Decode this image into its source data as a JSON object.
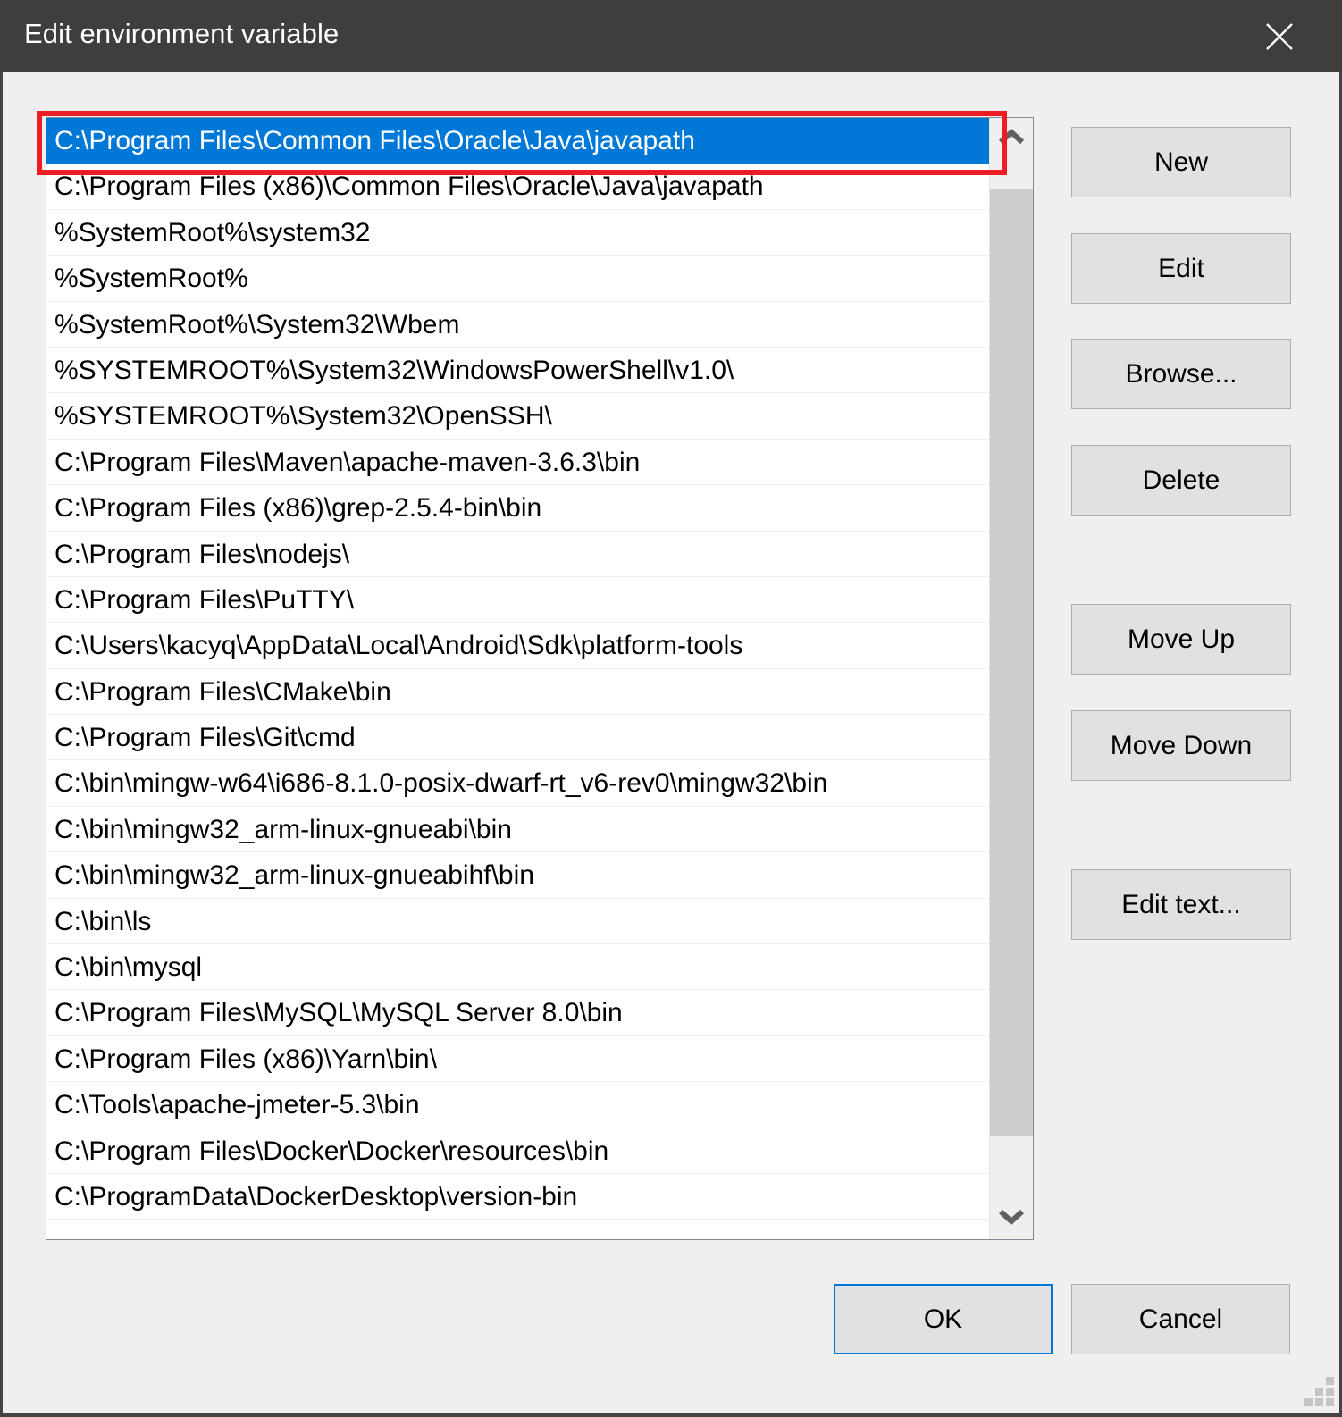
{
  "window": {
    "title": "Edit environment variable",
    "close_icon": "close-icon"
  },
  "colors": {
    "titlebar_bg": "#403e3c",
    "selection_blue": "#0078d7",
    "annotation_red": "#ec1c24",
    "dialog_bg": "#efefef",
    "button_face": "#e1e1e1",
    "scroll_thumb": "#cdcdcd"
  },
  "list": {
    "selected_index": 0,
    "items": [
      "C:\\Program Files\\Common Files\\Oracle\\Java\\javapath",
      "C:\\Program Files (x86)\\Common Files\\Oracle\\Java\\javapath",
      "%SystemRoot%\\system32",
      "%SystemRoot%",
      "%SystemRoot%\\System32\\Wbem",
      "%SYSTEMROOT%\\System32\\WindowsPowerShell\\v1.0\\",
      "%SYSTEMROOT%\\System32\\OpenSSH\\",
      "C:\\Program Files\\Maven\\apache-maven-3.6.3\\bin",
      "C:\\Program Files (x86)\\grep-2.5.4-bin\\bin",
      "C:\\Program Files\\nodejs\\",
      "C:\\Program Files\\PuTTY\\",
      "C:\\Users\\kacyq\\AppData\\Local\\Android\\Sdk\\platform-tools",
      "C:\\Program Files\\CMake\\bin",
      "C:\\Program Files\\Git\\cmd",
      "C:\\bin\\mingw-w64\\i686-8.1.0-posix-dwarf-rt_v6-rev0\\mingw32\\bin",
      "C:\\bin\\mingw32_arm-linux-gnueabi\\bin",
      "C:\\bin\\mingw32_arm-linux-gnueabihf\\bin",
      "C:\\bin\\ls",
      "C:\\bin\\mysql",
      "C:\\Program Files\\MySQL\\MySQL Server 8.0\\bin",
      "C:\\Program Files (x86)\\Yarn\\bin\\",
      "C:\\Tools\\apache-jmeter-5.3\\bin",
      "C:\\Program Files\\Docker\\Docker\\resources\\bin",
      "C:\\ProgramData\\DockerDesktop\\version-bin"
    ]
  },
  "scrollbar": {
    "up_icon": "chevron-up-icon",
    "down_icon": "chevron-down-icon"
  },
  "buttons": {
    "new": "New",
    "edit": "Edit",
    "browse": "Browse...",
    "delete": "Delete",
    "move_up": "Move Up",
    "move_down": "Move Down",
    "edit_text": "Edit text...",
    "ok": "OK",
    "cancel": "Cancel"
  }
}
